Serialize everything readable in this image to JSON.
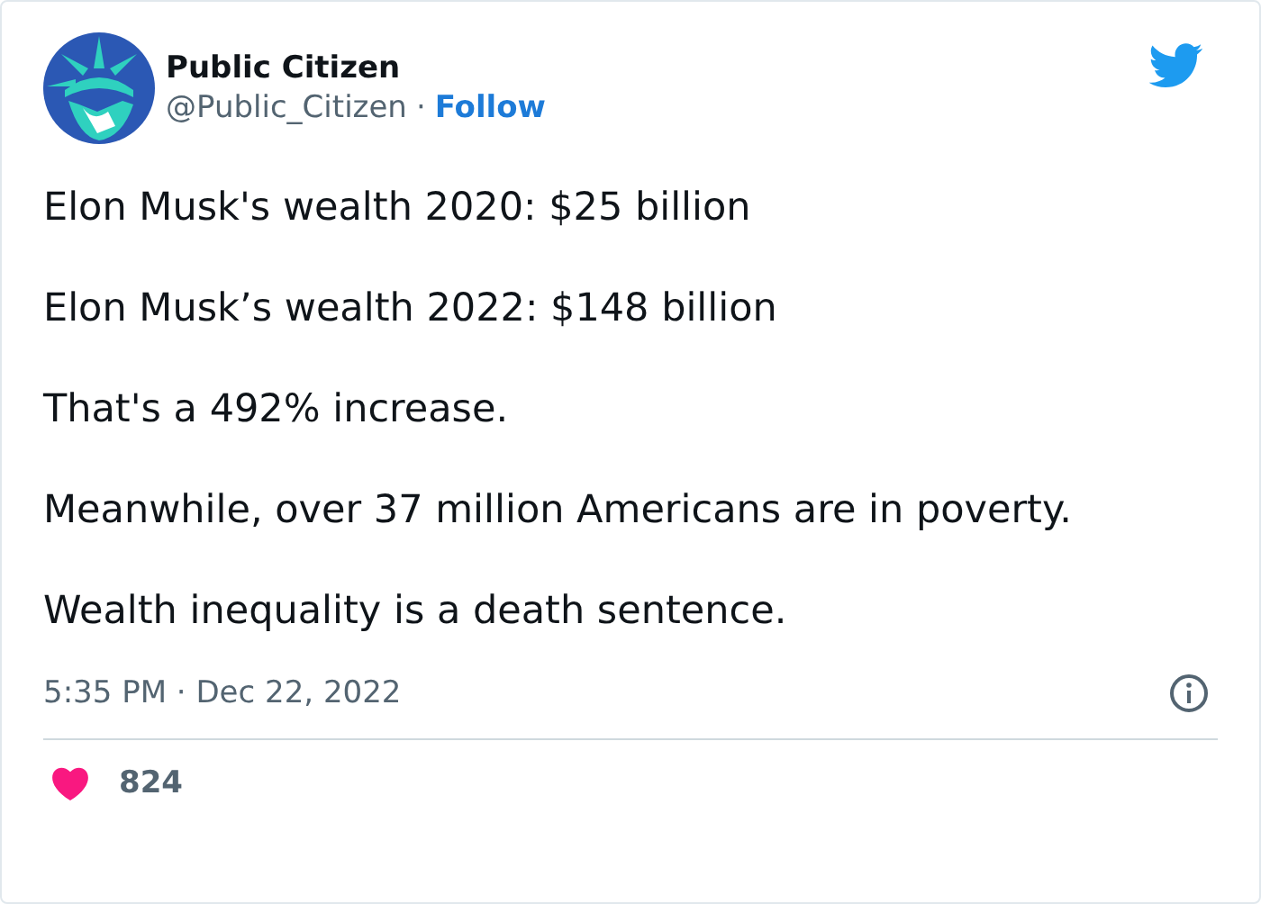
{
  "author": {
    "name": "Public Citizen",
    "handle": "@Public_Citizen",
    "separator": "·",
    "follow": "Follow"
  },
  "paragraphs": [
    "Elon Musk's wealth 2020: $25 billion",
    "Elon Musk’s wealth 2022: $148 billion",
    "That's a 492% increase.",
    "Meanwhile, over 37 million Americans are in poverty.",
    "Wealth inequality is a death sentence."
  ],
  "timestamp": "5:35 PM · Dec 22, 2022",
  "likes": "824"
}
